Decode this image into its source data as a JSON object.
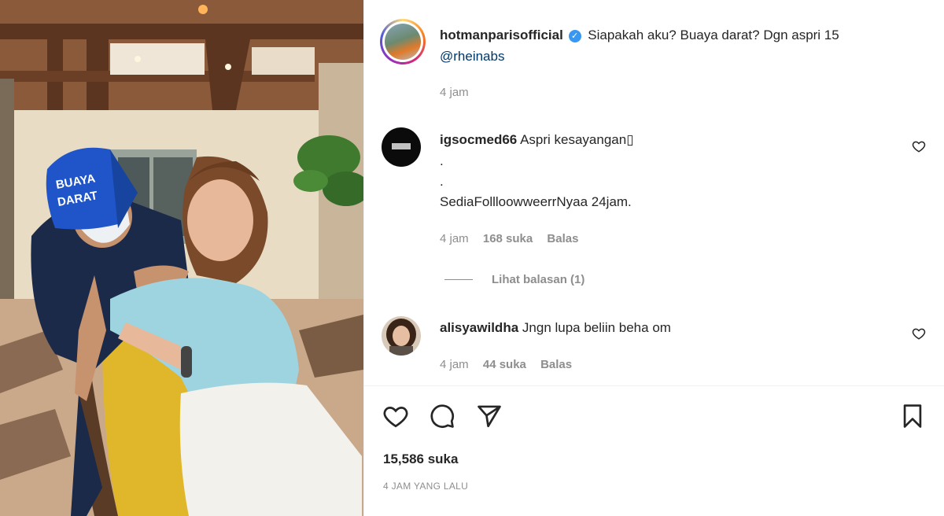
{
  "post": {
    "author": "hotmanparisofficial",
    "caption": "Siapakah aku? Buaya darat? Dgn aspri 15",
    "mention": "@rheinabs",
    "time": "4 jam",
    "cap_text": "BUAYA DARAT"
  },
  "comments": [
    {
      "username": "igsocmed66",
      "text": "Aspri kesayangan▯",
      "extra_lines": [
        ".",
        ".",
        "SediaFollloowweerrNyaa 24jam."
      ],
      "time": "4 jam",
      "likes": "168 suka",
      "reply": "Balas",
      "view_replies": "Lihat balasan (1)"
    },
    {
      "username": "alisyawildha",
      "text": "Jngn lupa beliin beha om",
      "time": "4 jam",
      "likes": "44 suka",
      "reply": "Balas"
    }
  ],
  "actions": {
    "like_icon": "heart-icon",
    "comment_icon": "comment-icon",
    "share_icon": "send-icon",
    "save_icon": "bookmark-icon"
  },
  "stats": {
    "likes": "15,586 suka",
    "posted": "4 JAM YANG LALU"
  },
  "colors": {
    "verified": "#3897f0",
    "mention": "#00376b",
    "muted": "#8e8e8e",
    "cap": "#1f55c9"
  }
}
